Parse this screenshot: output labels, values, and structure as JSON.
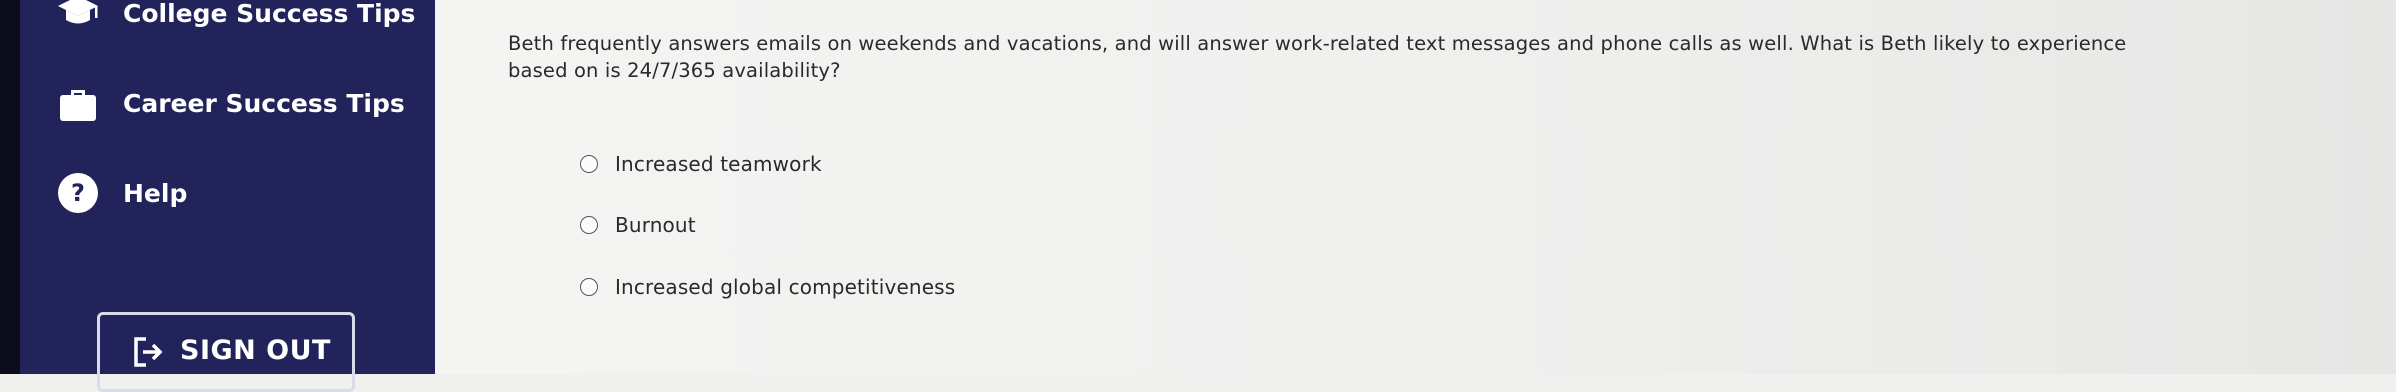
{
  "sidebar": {
    "items": [
      {
        "label": "College Success Tips",
        "icon": "graduation-cap-icon"
      },
      {
        "label": "Career Success Tips",
        "icon": "briefcase-icon"
      },
      {
        "label": "Help",
        "icon": "help-icon"
      }
    ],
    "sign_out_label": "SIGN OUT",
    "colors": {
      "background": "#21235a",
      "text": "#ffffff"
    }
  },
  "question": {
    "text": "Beth frequently answers emails on weekends and vacations, and will answer work-related text messages and phone calls as well. What is Beth likely to experience based on is 24/7/365 availability?",
    "options": [
      {
        "label": "Increased teamwork",
        "selected": false
      },
      {
        "label": "Burnout",
        "selected": false
      },
      {
        "label": "Increased global competitiveness",
        "selected": false
      }
    ]
  }
}
